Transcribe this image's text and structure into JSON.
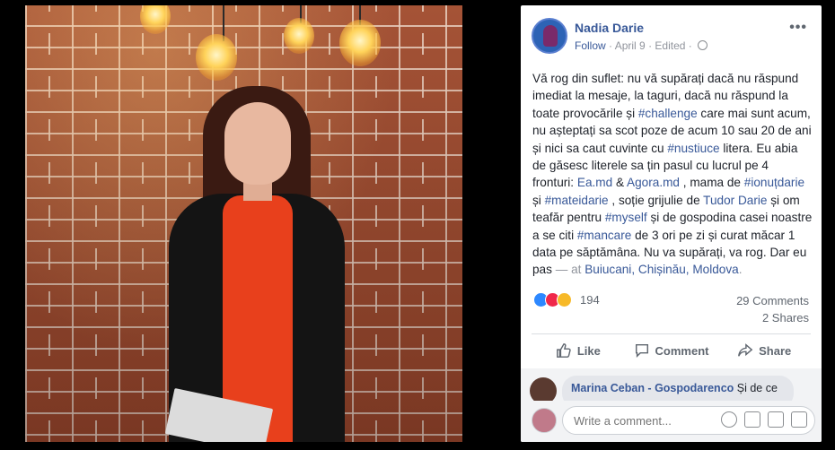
{
  "post": {
    "author": "Nadia Darie",
    "follow": "Follow",
    "date": "April 9",
    "edited": "Edited",
    "more": "•••",
    "text": {
      "p1": "Vă rog din suflet: nu vă supărați dacă nu răspund imediat la mesaje, la taguri, dacă nu răspund la toate provocările și ",
      "tag_challenge": "#challenge",
      "p2": " care mai sunt acum, nu așteptați sa scot poze de acum 10 sau 20 de ani și nici sa caut cuvinte cu ",
      "tag_nustiuce": "#nustiuce",
      "p3": " litera. Eu abia de găsesc literele sa țin pasul cu lucrul pe 4 fronturi: ",
      "link_ea": "Ea.md",
      "amp": " & ",
      "link_agora": "Agora.md",
      "p4": " , mama de ",
      "tag_ionut": "#ionuțdarie",
      "p5": " și ",
      "tag_matei": "#mateidarie",
      "p6": " , soție grijulie de ",
      "link_tudor": "Tudor Darie",
      "p7": " și om teafăr pentru ",
      "tag_myself": "#myself",
      "p8": " și de gospodina casei noastre a se citi ",
      "tag_mancare": "#mancare",
      "p9": " de 3 ori pe zi și curat măcar 1 data pe săptămâna. Nu va supărați, va rog. Dar eu pas",
      "at": " — at ",
      "location": "Buiucani, Chișinău, Moldova",
      "period": "."
    },
    "reaction_count": "194",
    "comments_count": "29 Comments",
    "shares_count": "2 Shares"
  },
  "actions": {
    "like": "Like",
    "comment": "Comment",
    "share": "Share"
  },
  "comment": {
    "author": "Marina Ceban - Gospodarenco",
    "text": " Și de ce"
  },
  "composer": {
    "placeholder": "Write a comment..."
  },
  "colors": {
    "link": "#385898",
    "like_blue": "#2d88ff",
    "love_red": "#f0284a",
    "haha_yellow": "#f7b928"
  }
}
